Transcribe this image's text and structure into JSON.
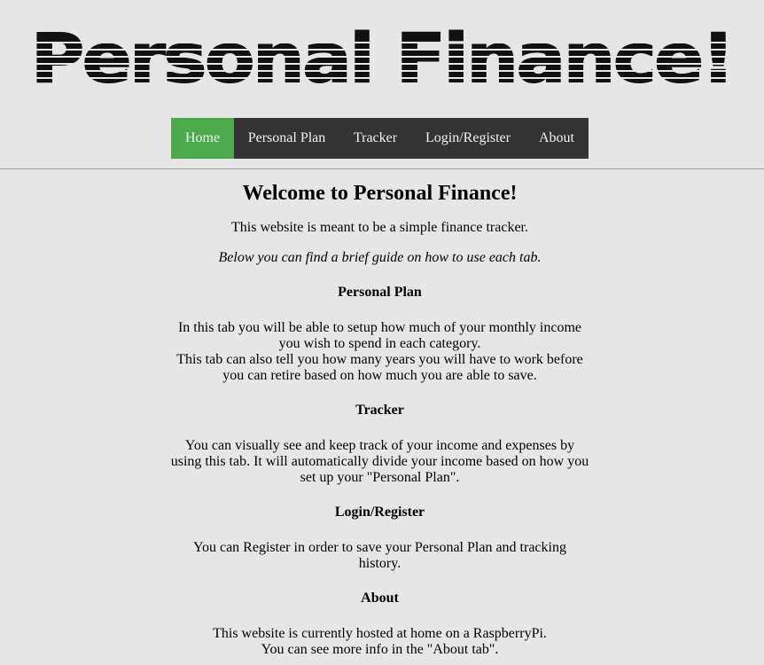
{
  "header": {
    "logo_text": "Personal Finance!"
  },
  "nav": {
    "items": [
      {
        "label": "Home",
        "active": true
      },
      {
        "label": "Personal Plan",
        "active": false
      },
      {
        "label": "Tracker",
        "active": false
      },
      {
        "label": "Login/Register",
        "active": false
      },
      {
        "label": "About",
        "active": false
      }
    ]
  },
  "main": {
    "title": "Welcome to Personal Finance!",
    "intro": "This website is meant to be a simple finance tracker.",
    "guide": "Below you can find a brief guide on how to use each tab.",
    "sections": [
      {
        "title": "Personal Plan",
        "lines": [
          "In this tab you will be able to setup how much of your monthly income you wish to spend in each category.",
          "This tab can also tell you how many years you will have to work before you can retire based on how much you are able to save."
        ]
      },
      {
        "title": "Tracker",
        "lines": [
          "You can visually see and keep track of your income and expenses by using this tab. It will automatically divide your income based on how you set up your \"Personal Plan\"."
        ]
      },
      {
        "title": "Login/Register",
        "lines": [
          "You can Register in order to save your Personal Plan and tracking history."
        ]
      },
      {
        "title": "About",
        "lines": [
          "This website is currently hosted at home on a RaspberryPi.",
          "You can see more info in the \"About tab\"."
        ]
      }
    ]
  },
  "colors": {
    "background": "#e6e6e6",
    "nav_bg": "#333333",
    "nav_active": "#4caa4c",
    "nav_text": "#f2f2f2"
  }
}
